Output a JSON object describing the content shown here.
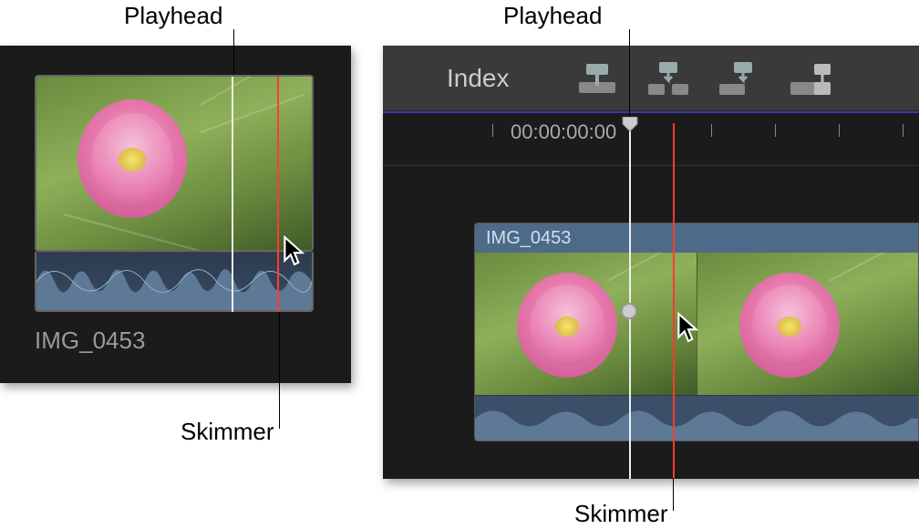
{
  "callouts": {
    "playhead_left": "Playhead",
    "playhead_right": "Playhead",
    "skimmer_left": "Skimmer",
    "skimmer_right": "Skimmer"
  },
  "browser": {
    "clip_name": "IMG_0453"
  },
  "timeline": {
    "toolbar": {
      "index_label": "Index"
    },
    "ruler": {
      "timecode": "00:00:00:00"
    },
    "clip": {
      "title": "IMG_0453"
    }
  }
}
